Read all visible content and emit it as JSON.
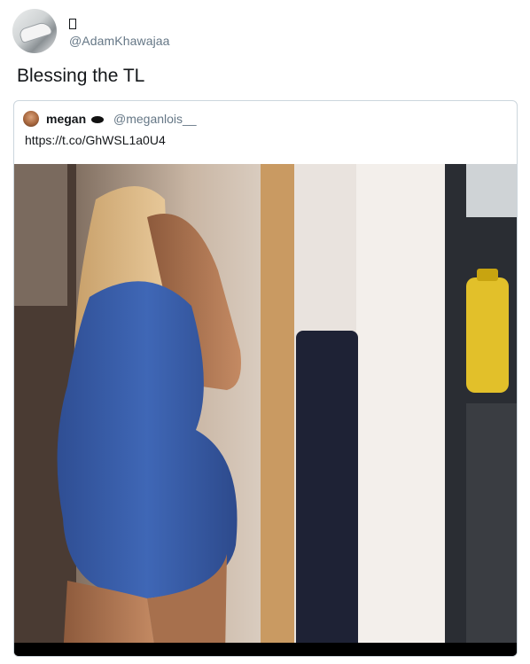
{
  "tweet": {
    "author_name": "",
    "author_handle": "@AdamKhawajaa",
    "text": "Blessing the TL"
  },
  "quoted_tweet": {
    "author_name": "megan",
    "author_handle": "@meganlois__",
    "link": "https://t.co/GhWSL1a0U4"
  },
  "icons": {
    "author_avatar": "avatar-photo",
    "quoted_avatar": "avatar-photo",
    "name_glyph": "missing-glyph-box",
    "quoted_badge": "emoji-badge"
  }
}
